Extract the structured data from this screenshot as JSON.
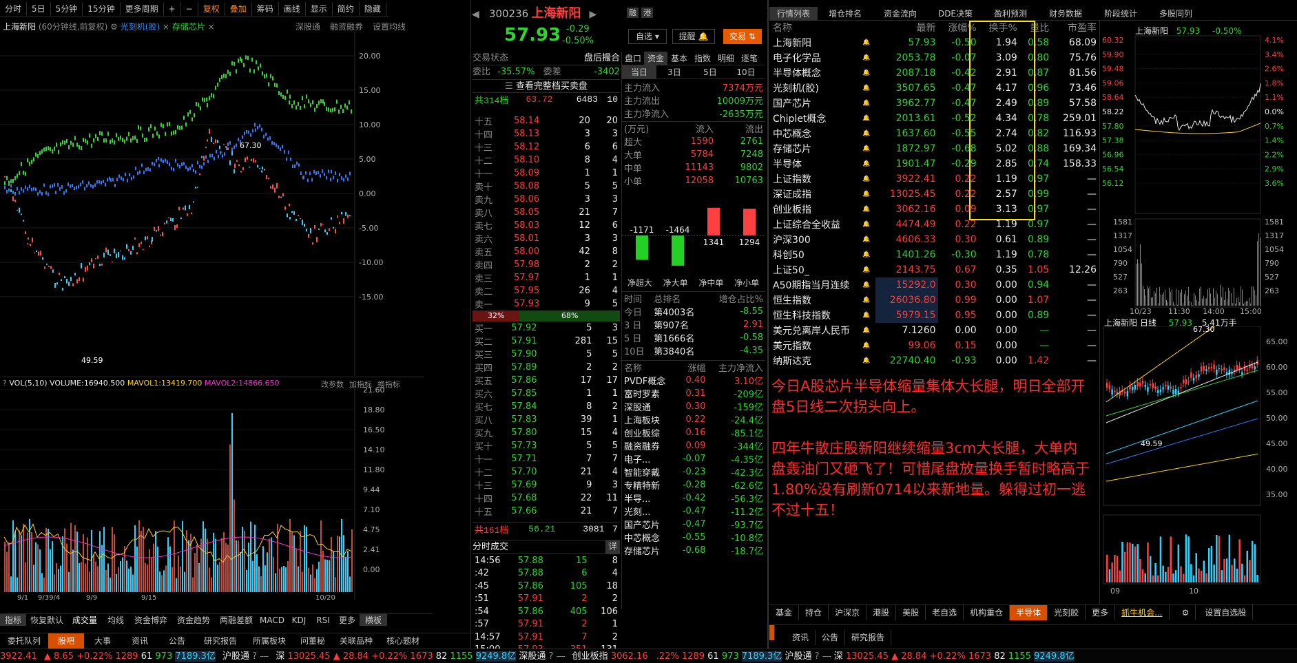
{
  "toolbar": {
    "items": [
      "分时",
      "5日",
      "5分钟",
      "15分钟",
      "更多周期",
      "+",
      "−",
      "复权",
      "叠加",
      "筹码",
      "画线",
      "显示",
      "简约",
      "隐藏"
    ]
  },
  "chart_header": {
    "name": "上海新阳",
    "desc": "(60分钟线,前复权)",
    "overlay1": "光刻机(胶)",
    "overlay2": "存储芯片",
    "links": [
      "深股通",
      "融资融券",
      "设置均线"
    ]
  },
  "main_chart": {
    "y_ticks": [
      "20.00",
      "15.00",
      "10.00",
      "5.00",
      "0.00",
      "-5.00",
      "-10.00",
      "-15.00"
    ],
    "hi_label": "67.30",
    "lo_label": "49.59",
    "x_ticks": [
      "9/1",
      "9/39/4",
      "9/9",
      "9/15",
      "10/20"
    ]
  },
  "vol": {
    "label": "VOL(5,10)",
    "volume": "VOLUME:16940.500",
    "mavol1": "MAVOL1:13419.700",
    "mavol2": "MAVOL2:14866.650",
    "links": [
      "改参数",
      "加指标",
      "换指标"
    ],
    "y_ticks": [
      "21.60",
      "18.80",
      "16.50",
      "14.10",
      "11.80",
      "9.44",
      "7.10",
      "4.75",
      "2.41",
      "0.00"
    ]
  },
  "left_tabs1": [
    "指标",
    "恢复默认",
    "成交量",
    "均线",
    "资金博弈",
    "资金趋势",
    "两融差额",
    "MACD",
    "KDJ",
    "RSI",
    "更多",
    "横板"
  ],
  "left_tabs2": [
    "委托队列",
    "股吧",
    "大事",
    "资讯",
    "公告",
    "研究报告",
    "所属板块",
    "问董秘",
    "关联品种",
    "核心题材"
  ],
  "stock": {
    "code": "300236",
    "name": "上海新阳",
    "price": "57.93",
    "chg": "-0.29",
    "pct": "-0.50%",
    "tags": [
      "融",
      "港"
    ],
    "btn_watch": "自选",
    "btn_alert": "提醒",
    "btn_trade": "交易"
  },
  "ob": {
    "status": "交易状态",
    "status_val": "盘后撮合",
    "wb_lbl": "委比",
    "wb": "-35.57%",
    "wc_lbl": "委差",
    "wc": "-3402",
    "full": "查看完整档买卖盘",
    "top_lbl": "共314档",
    "top_p": "63.72",
    "top_v": "6483",
    "top_c": "10",
    "asks": [
      [
        "十五",
        "58.14",
        "20",
        "20"
      ],
      [
        "十四",
        "58.13",
        "3",
        "3"
      ],
      [
        "十三",
        "58.12",
        "6",
        "6"
      ],
      [
        "十二",
        "58.10",
        "8",
        "4"
      ],
      [
        "十一",
        "58.09",
        "1",
        "1"
      ],
      [
        "卖十",
        "58.08",
        "5",
        "5"
      ],
      [
        "卖九",
        "58.06",
        "3",
        "3"
      ],
      [
        "卖八",
        "58.05",
        "21",
        "7"
      ],
      [
        "卖七",
        "58.03",
        "12",
        "6"
      ],
      [
        "卖六",
        "58.01",
        "3",
        "3"
      ],
      [
        "卖五",
        "58.00",
        "42",
        "8"
      ],
      [
        "卖四",
        "57.98",
        "2",
        "2"
      ],
      [
        "卖三",
        "57.97",
        "1",
        "1"
      ],
      [
        "卖二",
        "57.95",
        "26",
        "4"
      ],
      [
        "卖一",
        "57.93",
        "9",
        "5"
      ]
    ],
    "ratio_l": "32%",
    "ratio_r": "68%",
    "bids": [
      [
        "买一",
        "57.92",
        "5",
        "3"
      ],
      [
        "买二",
        "57.91",
        "281",
        "15"
      ],
      [
        "买三",
        "57.90",
        "5",
        "5"
      ],
      [
        "买四",
        "57.89",
        "2",
        "2"
      ],
      [
        "买五",
        "57.86",
        "17",
        "17"
      ],
      [
        "买六",
        "57.85",
        "1",
        "1"
      ],
      [
        "买七",
        "57.84",
        "8",
        "2"
      ],
      [
        "买八",
        "57.83",
        "39",
        "1"
      ],
      [
        "买九",
        "57.80",
        "15",
        "4"
      ],
      [
        "买十",
        "57.73",
        "5",
        "5"
      ],
      [
        "十一",
        "57.71",
        "7",
        "7"
      ],
      [
        "十二",
        "57.70",
        "21",
        "4"
      ],
      [
        "十三",
        "57.69",
        "9",
        "3"
      ],
      [
        "十四",
        "57.68",
        "22",
        "11"
      ],
      [
        "十五",
        "57.66",
        "21",
        "7"
      ]
    ],
    "bot_lbl": "共161档",
    "bot_p": "56.21",
    "bot_v": "3081",
    "bot_c": "7"
  },
  "ticks": {
    "title": "分时成交",
    "detail": "详",
    "rows": [
      [
        "14:56",
        "57.88",
        "15",
        "8"
      ],
      [
        ":42",
        "57.88",
        "6",
        "4"
      ],
      [
        ":45",
        "57.86",
        "105",
        "18"
      ],
      [
        ":51",
        "57.91",
        "2",
        "2"
      ],
      [
        ":54",
        "57.86",
        "405",
        "106"
      ],
      [
        ":57",
        "57.91",
        "2",
        "1"
      ],
      [
        "14:57",
        "57.91",
        "7",
        "2"
      ],
      [
        "15:00",
        "57.93",
        "351",
        "131"
      ]
    ]
  },
  "flow": {
    "tabs": [
      "盘口",
      "资金",
      "基本",
      "指数",
      "明细",
      "逐笔"
    ],
    "periods": [
      "当日",
      "3日",
      "5日",
      "10日"
    ],
    "in_lbl": "主力流入",
    "in": "7374万元",
    "out_lbl": "主力流出",
    "out": "10009万元",
    "net_lbl": "主力净流入",
    "net": "-2635万元",
    "hdr": [
      "(万元)",
      "流入",
      "流出"
    ],
    "rows": [
      [
        "超大",
        "1590",
        "2761"
      ],
      [
        "大单",
        "5784",
        "7248"
      ],
      [
        "中单",
        "11143",
        "9802"
      ],
      [
        "小单",
        "12058",
        "10763"
      ]
    ],
    "bars": {
      "vals": [
        "-1171",
        "-1464",
        "1341",
        "1294"
      ],
      "labels": [
        "净超大",
        "净大单",
        "净中单",
        "净小单"
      ]
    },
    "rank_hdr": [
      "时间",
      "总排名",
      "增仓占比%"
    ],
    "rank": [
      [
        "今日",
        "第4003名",
        "-8.55"
      ],
      [
        "3 日",
        "第907名",
        "2.91"
      ],
      [
        "5 日",
        "第1666名",
        "-0.58"
      ],
      [
        "10日",
        "第3840名",
        "-4.35"
      ]
    ],
    "sec_hdr": [
      "名称",
      "涨幅",
      "主力净流入"
    ],
    "sectors": [
      [
        "PVDF概念",
        "0.40",
        "3.10亿"
      ],
      [
        "富时罗素",
        "0.31",
        "-209亿"
      ],
      [
        "深股通",
        "0.30",
        "-159亿"
      ],
      [
        "上海板块",
        "0.22",
        "-24.4亿"
      ],
      [
        "创业板综",
        "0.16",
        "-85.1亿"
      ],
      [
        "融资融券",
        "0.09",
        "-344亿"
      ],
      [
        "电子...",
        "-0.07",
        "-4.35亿"
      ],
      [
        "智能穿戴",
        "-0.23",
        "-42.3亿"
      ],
      [
        "专精特新",
        "-0.28",
        "-62.6亿"
      ],
      [
        "半导...",
        "-0.42",
        "-56.3亿"
      ],
      [
        "光刻...",
        "-0.47",
        "-11.2亿"
      ],
      [
        "国产芯片",
        "-0.47",
        "-93.7亿"
      ],
      [
        "中芯概念",
        "-0.55",
        "-10.8亿"
      ],
      [
        "存储芯片",
        "-0.68",
        "-18.7亿"
      ]
    ]
  },
  "quotes": {
    "tabs": [
      "行情列表",
      "增仓排名",
      "资金流向",
      "DDE决策",
      "盈利预测",
      "财务数据",
      "阶段统计",
      "多股同列"
    ],
    "hdr": [
      "名称",
      "",
      "最新",
      "涨幅%",
      "换手%",
      "量比",
      "市盈率"
    ],
    "rows": [
      [
        "上海新阳",
        "57.93",
        "-0.50",
        "1.94",
        "0.58",
        "68.09"
      ],
      [
        "电子化学品",
        "2053.78",
        "-0.07",
        "3.09",
        "0.80",
        "75.76"
      ],
      [
        "半导体概念",
        "2087.18",
        "-0.42",
        "2.91",
        "0.87",
        "81.56"
      ],
      [
        "光刻机(胶)",
        "3507.65",
        "-0.47",
        "4.17",
        "0.96",
        "73.46"
      ],
      [
        "国产芯片",
        "3962.77",
        "-0.47",
        "2.49",
        "0.89",
        "57.58"
      ],
      [
        "Chiplet概念",
        "2013.61",
        "-0.52",
        "4.34",
        "0.78",
        "259.01"
      ],
      [
        "中芯概念",
        "1637.60",
        "-0.55",
        "2.74",
        "0.82",
        "116.93"
      ],
      [
        "存储芯片",
        "1872.97",
        "-0.68",
        "5.02",
        "0.88",
        "169.34"
      ],
      [
        "半导体",
        "1901.47",
        "-0.29",
        "2.85",
        "0.74",
        "158.33"
      ],
      [
        "上证指数",
        "3922.41",
        "0.22",
        "1.19",
        "0.97",
        "—"
      ],
      [
        "深证成指",
        "13025.45",
        "0.22",
        "2.57",
        "0.99",
        "—"
      ],
      [
        "创业板指",
        "3062.16",
        "0.09",
        "3.13",
        "0.97",
        "—"
      ],
      [
        "上证综合全收益",
        "4474.49",
        "0.22",
        "1.19",
        "0.97",
        "—"
      ],
      [
        "沪深300",
        "4606.33",
        "0.30",
        "0.61",
        "0.89",
        "—"
      ],
      [
        "科创50",
        "1401.26",
        "-0.30",
        "1.19",
        "0.78",
        "—"
      ],
      [
        "上证50_",
        "2143.75",
        "0.67",
        "0.35",
        "1.05",
        "12.26"
      ],
      [
        "A50期指当月连续",
        "15292.0",
        "0.30",
        "0.00",
        "0.94",
        "—"
      ],
      [
        "恒生指数",
        "26036.80",
        "0.99",
        "0.00",
        "1.07",
        "—"
      ],
      [
        "恒生科技指数",
        "5979.15",
        "0.95",
        "0.00",
        "0.89",
        "—"
      ],
      [
        "美元兑离岸人民币",
        "7.1260",
        "0.00",
        "0.00",
        "—",
        "—"
      ],
      [
        "美元指数",
        "99.06",
        "0.15",
        "0.00",
        "—",
        "—"
      ],
      [
        "纳斯达克",
        "22740.40",
        "-0.93",
        "0.00",
        "1.42",
        "—"
      ]
    ]
  },
  "note": {
    "p1": "今日A股芯片半导体缩量集体大长腿，明日全部开盘5日线二次拐头向上。",
    "p2": "四年牛散庄股新阳继续缩量3cm大长腿，大单内盘轰油门又砸飞了！可惜尾盘放量换手暂时略高于1.80%没有刷新0714以来新地量。躲得过初一逃不过十五！"
  },
  "mini": {
    "name": "上海新阳",
    "price": "57.93",
    "pct": "-0.50%",
    "left_ticks": [
      "60.32",
      "59.90",
      "59.48",
      "59.06",
      "58.64",
      "58.22",
      "57.80",
      "57.38",
      "56.96",
      "56.54",
      "56.12"
    ],
    "right_ticks": [
      "4.1%",
      "3.4%",
      "2.6%",
      "1.8%",
      "1.1%",
      "0.0%",
      "0.7%",
      "1.4%",
      "2.2%",
      "2.9%",
      "3.6%"
    ],
    "vol_ticks": [
      "1581",
      "1317",
      "1054",
      "790",
      "527",
      "263"
    ],
    "x_ticks": [
      "10/23",
      "11:30",
      "14:00",
      "15:00"
    ]
  },
  "daily": {
    "name": "上海新阳 日线",
    "price": "57.93",
    "vol": "5.41万手",
    "hi": "67.30",
    "lo": "49.59",
    "ticks": [
      "65.00",
      "60.00",
      "55.00",
      "50.00",
      "45.00",
      "40.00",
      "35.00"
    ],
    "x_ticks": [
      "09",
      "10"
    ]
  },
  "bottom_tabs": [
    "基金",
    "持仓",
    "沪深京",
    "港股",
    "美股",
    "老自选",
    "机构重仓",
    "半导体",
    "光刻胶",
    "更多",
    "抓牛机会...",
    "设置自选股"
  ],
  "bottom_tabs2": [
    "资讯",
    "公告",
    "研究报告"
  ],
  "status": {
    "sh": "3922.41",
    "sh_chg": "8.65",
    "sh_pct": "+0.22%",
    "sh_up": "1289",
    "sh_flat": "61",
    "sh_dn": "973",
    "sh_amt": "7189.3亿",
    "hgt": "沪股通",
    "sz_lbl": "深",
    "sz": "13025.45",
    "sz_chg": "28.84",
    "sz_pct": "+0.22%",
    "sz_up": "1673",
    "sz_flat": "82",
    "sz_dn": "1155",
    "sz_amt": "9249.8亿",
    "sgt": "深股通",
    "cyb": "创业板指",
    "cyb_v": "3062.16",
    "r_pct": ".22%",
    "r_up": "1289",
    "r_flat": "61",
    "r_dn": "973",
    "r_amt": "7189.3亿",
    "r_hgt": "沪股通",
    "r_sz": "深",
    "r_szv": "13025.45",
    "r_chg": "28.84",
    "r_pct2": "+0.22%",
    "r_up2": "1673",
    "r_flat2": "82",
    "r_dn2": "1155",
    "r_amt2": "9249.8亿"
  }
}
